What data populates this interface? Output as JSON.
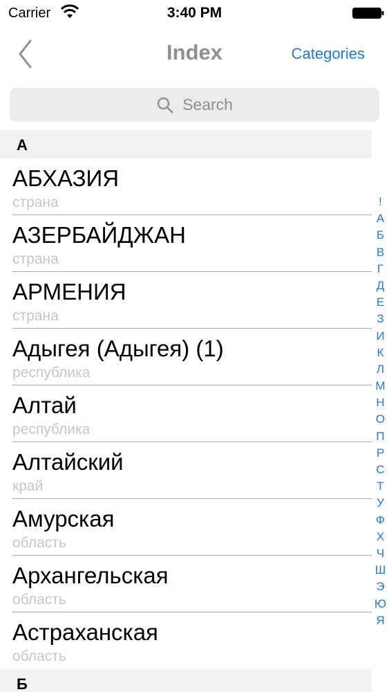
{
  "status": {
    "carrier": "Carrier",
    "time": "3:40 PM"
  },
  "nav": {
    "title": "Index",
    "right_label": "Categories"
  },
  "search": {
    "placeholder": "Search"
  },
  "sections": [
    {
      "letter": "А",
      "rows": [
        {
          "title": "АБХАЗИЯ",
          "subtitle": "страна"
        },
        {
          "title": "АЗЕРБАЙДЖАН",
          "subtitle": "страна"
        },
        {
          "title": "АРМЕНИЯ",
          "subtitle": "страна"
        },
        {
          "title": "Адыгея (Адыгея) (1)",
          "subtitle": "республика"
        },
        {
          "title": "Алтай",
          "subtitle": "республика"
        },
        {
          "title": "Алтайский",
          "subtitle": "край"
        },
        {
          "title": "Амурская",
          "subtitle": "область"
        },
        {
          "title": "Архангельская",
          "subtitle": "область"
        },
        {
          "title": "Астраханская",
          "subtitle": "область"
        }
      ]
    },
    {
      "letter": "Б",
      "rows": []
    }
  ],
  "index": [
    "!",
    "А",
    "Б",
    "В",
    "Г",
    "Д",
    "Е",
    "З",
    "И",
    "К",
    "Л",
    "М",
    "Н",
    "О",
    "П",
    "Р",
    "С",
    "Т",
    "У",
    "Ф",
    "Х",
    "Ч",
    "Ш",
    "Э",
    "Ю",
    "Я"
  ],
  "colors": {
    "accent": "#1d7ae0",
    "subtitle": "#c6c6c9",
    "section_bg": "#f1f1f2",
    "search_bg": "#ebebec"
  }
}
